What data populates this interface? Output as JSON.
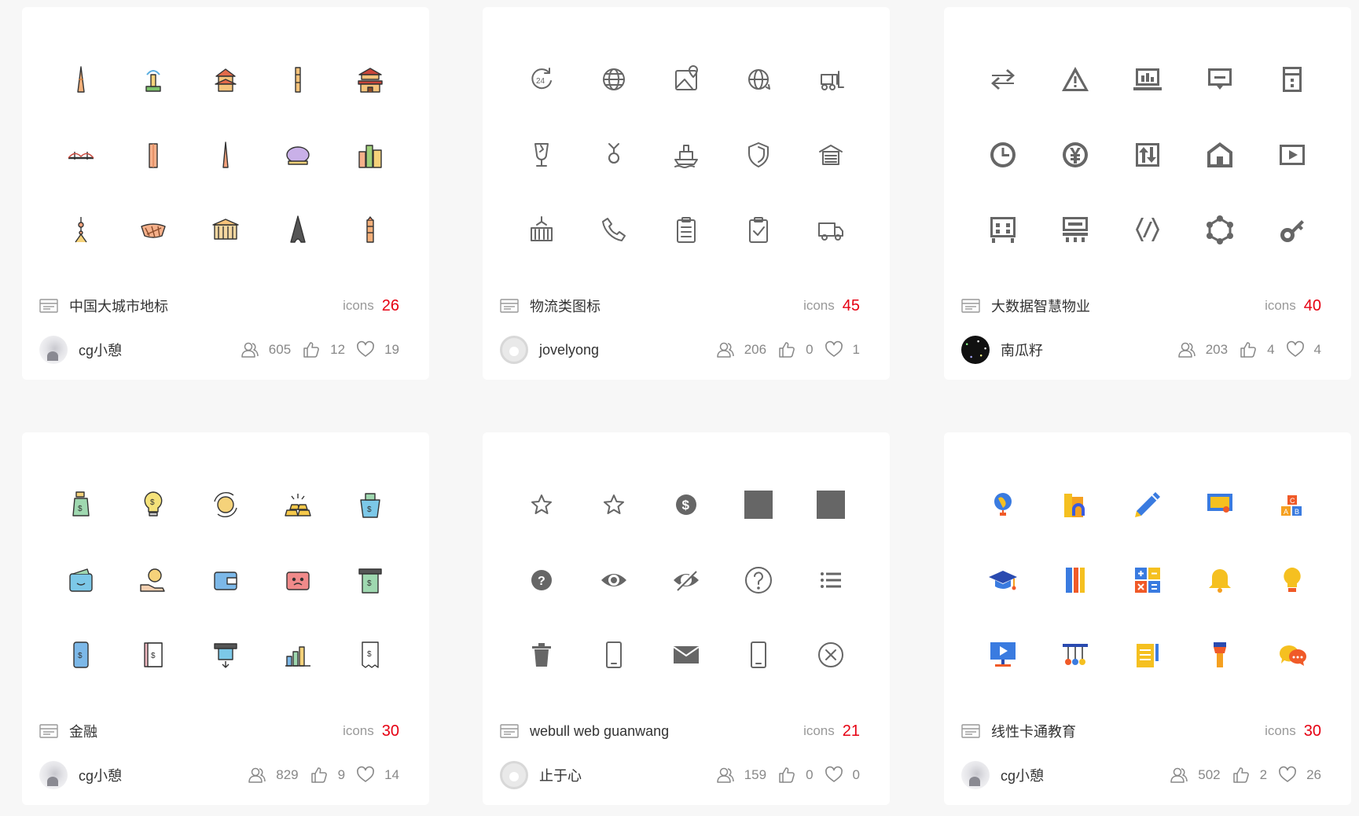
{
  "cards": [
    {
      "title": "中国大城市地标",
      "icons_label": "icons",
      "count": "26",
      "author": "cg小憩",
      "avatar": "photo",
      "views": "605",
      "likes": "12",
      "favorites": "19",
      "icon_style": "landmark-color",
      "icons": [
        "tower-pagoda-icon",
        "fountain-icon",
        "temple-icon",
        "tall-tower-icon",
        "palace-gate-icon",
        "bridge-icon",
        "skyscraper-icon",
        "spire-icon",
        "dome-icon",
        "city-skyline-icon",
        "tv-tower-icon",
        "birds-nest-stadium-icon",
        "great-hall-icon",
        "eiffel-tower-icon",
        "pagoda-icon"
      ]
    },
    {
      "title": "物流类图标",
      "icons_label": "icons",
      "count": "45",
      "author": "jovelyong",
      "avatar": "default",
      "views": "206",
      "likes": "0",
      "favorites": "1",
      "icon_style": "outline-gray",
      "icons": [
        "24h-service-icon",
        "globe-icon",
        "map-location-icon",
        "globe-refresh-icon",
        "forklift-icon",
        "fragile-glass-icon",
        "hook-icon",
        "ship-icon",
        "shield-icon",
        "warehouse-icon",
        "container-crane-icon",
        "phone-icon",
        "clipboard-list-icon",
        "clipboard-check-icon",
        "delivery-truck-icon"
      ]
    },
    {
      "title": "大数据智慧物业",
      "icons_label": "icons",
      "count": "40",
      "author": "南瓜籽",
      "avatar": "space",
      "views": "203",
      "likes": "4",
      "favorites": "4",
      "icon_style": "solid-gray",
      "icons": [
        "exchange-arrows-icon",
        "warning-triangle-icon",
        "dashboard-monitor-icon",
        "message-box-icon",
        "building-panel-icon",
        "clock-icon",
        "yen-coin-icon",
        "up-down-transfer-icon",
        "home-icon",
        "play-screen-icon",
        "storefront-icon",
        "kiosk-icon",
        "code-brackets-icon",
        "hexagon-network-icon",
        "key-icon"
      ]
    },
    {
      "title": "金融",
      "icons_label": "icons",
      "count": "30",
      "author": "cg小憩",
      "avatar": "photo",
      "views": "829",
      "likes": "9",
      "favorites": "14",
      "icon_style": "finance-color",
      "icons": [
        "money-bag-icon",
        "lightbulb-coin-icon",
        "coin-cycle-icon",
        "gold-bars-icon",
        "money-bucket-icon",
        "smile-wallet-icon",
        "hand-coin-icon",
        "wallet-icon",
        "sad-wallet-icon",
        "atm-cash-icon",
        "mobile-payment-icon",
        "account-book-icon",
        "atm-withdraw-icon",
        "bar-chart-yen-icon",
        "receipt-icon"
      ]
    },
    {
      "title": "webull web guanwang",
      "icons_label": "icons",
      "count": "21",
      "author": "止于心",
      "avatar": "default",
      "views": "159",
      "likes": "0",
      "favorites": "0",
      "icon_style": "ui-gray",
      "icons": [
        "star-outline-icon",
        "star-outline-small-icon",
        "dollar-circle-icon",
        "square-solid-icon",
        "square-solid-icon",
        "question-solid-icon",
        "eye-icon",
        "eye-off-icon",
        "question-outline-icon",
        "list-icon",
        "trash-icon",
        "mobile-phone-icon",
        "envelope-icon",
        "mobile-phone-outline-icon",
        "close-circle-icon"
      ]
    },
    {
      "title": "线性卡通教育",
      "icons_label": "icons",
      "count": "30",
      "author": "cg小憩",
      "avatar": "photo",
      "views": "502",
      "likes": "2",
      "favorites": "26",
      "icon_style": "education-color",
      "icons": [
        "globe-stand-icon",
        "books-magnet-icon",
        "pen-icon",
        "presentation-board-icon",
        "abc-blocks-icon",
        "graduation-cap-icon",
        "ruler-books-icon",
        "calculator-icon",
        "bell-icon",
        "lightbulb-icon",
        "projector-screen-icon",
        "abacus-icon",
        "notebook-pencil-icon",
        "lamp-icon",
        "chat-bubbles-icon"
      ]
    }
  ]
}
